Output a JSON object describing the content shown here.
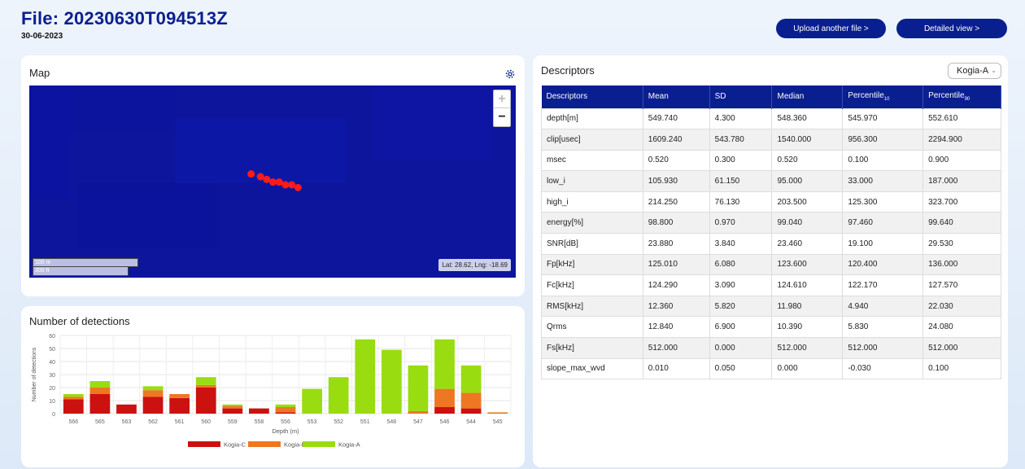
{
  "header": {
    "title": "File: 20230630T094513Z",
    "date": "30-06-2023",
    "upload_label": "Upload another file >",
    "detail_label": "Detailed view >"
  },
  "map": {
    "title": "Map",
    "zoom_in": "+",
    "zoom_out": "−",
    "scale_m": "100 m",
    "scale_ft": "300 ft",
    "latlng": "Lat: 28.62, Lng: -18.69"
  },
  "descriptors": {
    "title": "Descriptors",
    "species": "Kogia-A",
    "columns": [
      "Descriptors",
      "Mean",
      "SD",
      "Median",
      "Percentile",
      "Percentile"
    ],
    "column_subs": [
      "",
      "",
      "",
      "",
      "10",
      "90"
    ],
    "rows": [
      [
        "depth[m]",
        "549.740",
        "4.300",
        "548.360",
        "545.970",
        "552.610"
      ],
      [
        "clip[usec]",
        "1609.240",
        "543.780",
        "1540.000",
        "956.300",
        "2294.900"
      ],
      [
        "msec",
        "0.520",
        "0.300",
        "0.520",
        "0.100",
        "0.900"
      ],
      [
        "low_i",
        "105.930",
        "61.150",
        "95.000",
        "33.000",
        "187.000"
      ],
      [
        "high_i",
        "214.250",
        "76.130",
        "203.500",
        "125.300",
        "323.700"
      ],
      [
        "energy[%]",
        "98.800",
        "0.970",
        "99.040",
        "97.460",
        "99.640"
      ],
      [
        "SNR[dB]",
        "23.880",
        "3.840",
        "23.460",
        "19.100",
        "29.530"
      ],
      [
        "Fp[kHz]",
        "125.010",
        "6.080",
        "123.600",
        "120.400",
        "136.000"
      ],
      [
        "Fc[kHz]",
        "124.290",
        "3.090",
        "124.610",
        "122.170",
        "127.570"
      ],
      [
        "RMS[kHz]",
        "12.360",
        "5.820",
        "11.980",
        "4.940",
        "22.030"
      ],
      [
        "Qrms",
        "12.840",
        "6.900",
        "10.390",
        "5.830",
        "24.080"
      ],
      [
        "Fs[kHz]",
        "512.000",
        "0.000",
        "512.000",
        "512.000",
        "512.000"
      ],
      [
        "slope_max_wvd",
        "0.010",
        "0.050",
        "0.000",
        "-0.030",
        "0.100"
      ]
    ]
  },
  "detections": {
    "title": "Number of detections"
  },
  "colors": {
    "brand": "#0a1f8f",
    "kogia_c": "#cc1111",
    "kogia_b": "#ee7722",
    "kogia_a": "#99dd11"
  },
  "chart_data": {
    "type": "bar",
    "stacked": true,
    "categories": [
      "566",
      "565",
      "563",
      "562",
      "561",
      "560",
      "559",
      "558",
      "556",
      "553",
      "552",
      "551",
      "548",
      "547",
      "546",
      "544",
      "545"
    ],
    "series": [
      {
        "name": "Kogia-C",
        "values": [
          11,
          15,
          7,
          13,
          12,
          20,
          4,
          4,
          1,
          0,
          0,
          0,
          0,
          0,
          5,
          4,
          0
        ]
      },
      {
        "name": "Kogia-B",
        "values": [
          2,
          5,
          0,
          5,
          3,
          2,
          2,
          0,
          4,
          0,
          0,
          0,
          0,
          2,
          14,
          12,
          1
        ]
      },
      {
        "name": "Kogia-A",
        "values": [
          2,
          5,
          0,
          3,
          0,
          6,
          1,
          0,
          2,
          19,
          28,
          57,
          49,
          35,
          38,
          21,
          0
        ]
      }
    ],
    "xlabel": "Depth (m)",
    "ylabel": "Number of detections",
    "ylim": [
      0,
      60
    ],
    "yticks": [
      0,
      10,
      20,
      30,
      40,
      50,
      60
    ],
    "grid": true,
    "legend": "bottom"
  },
  "track_points": [
    [
      -18.6935,
      28.6212
    ],
    [
      -18.6932,
      28.6211
    ],
    [
      -18.693,
      28.621
    ],
    [
      -18.6928,
      28.6209
    ],
    [
      -18.6926,
      28.6209
    ],
    [
      -18.6924,
      28.6208
    ],
    [
      -18.6922,
      28.6208
    ],
    [
      -18.692,
      28.6207
    ]
  ]
}
